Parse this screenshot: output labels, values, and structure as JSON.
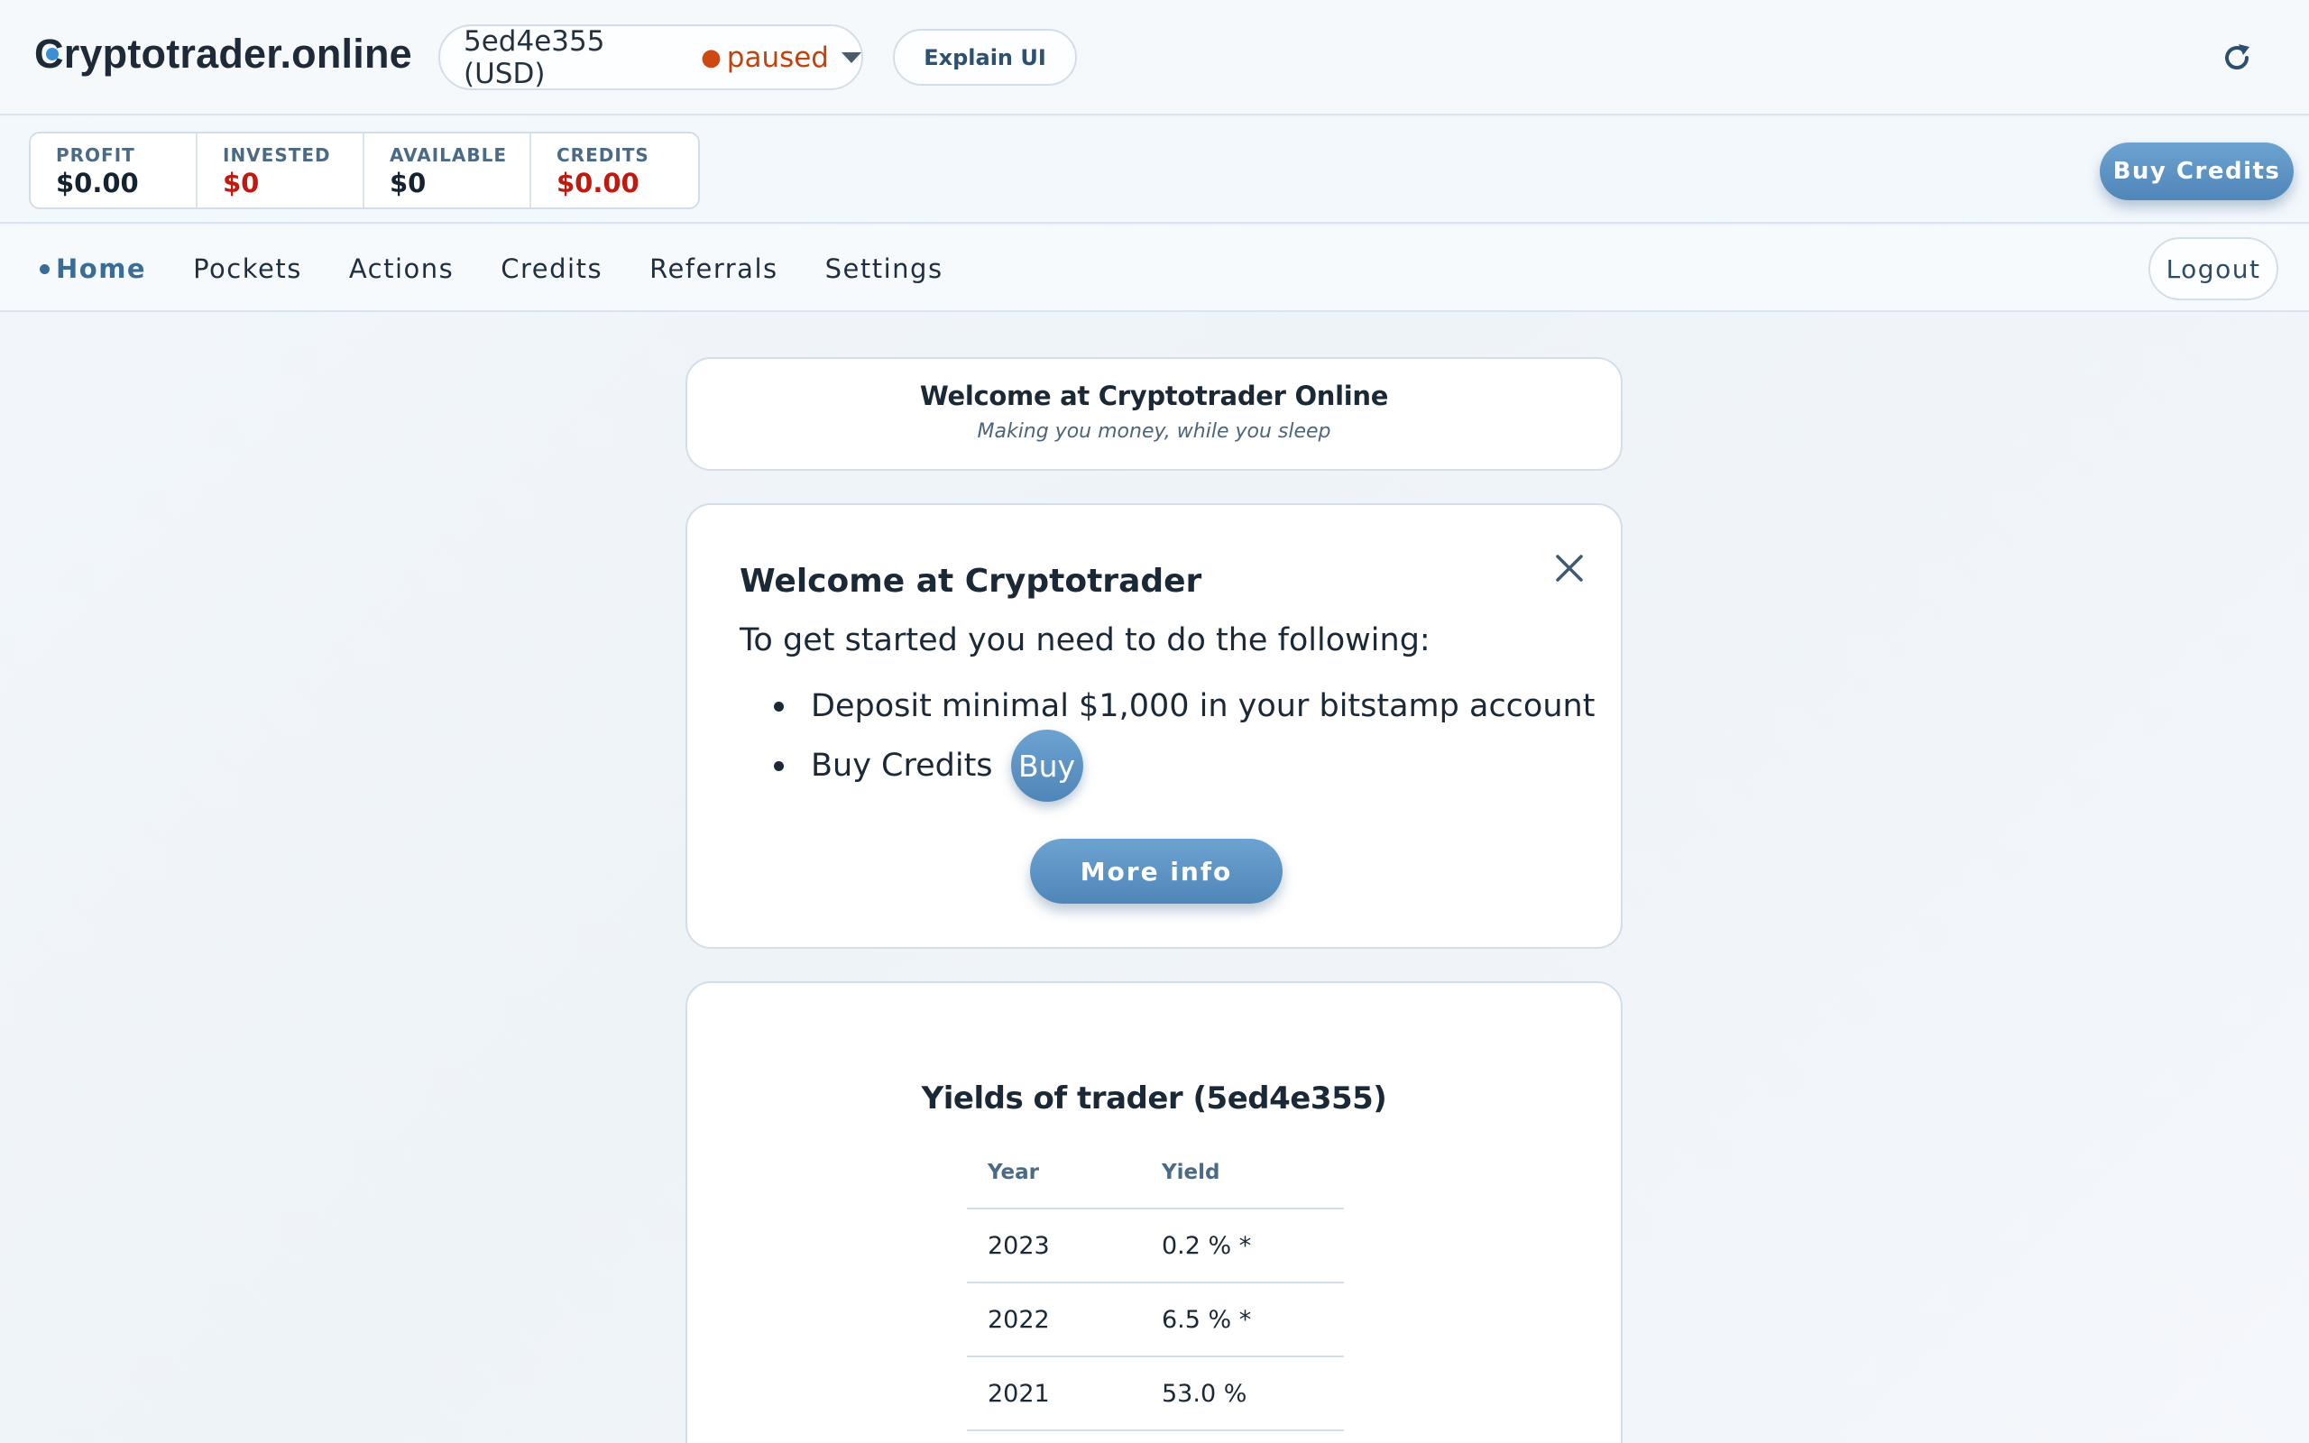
{
  "header": {
    "logo_text": "Cryptotrader.online",
    "trader": {
      "id_label": "5ed4e355 (USD)",
      "status_dot": "●",
      "status": "paused",
      "status_color": "#c3430d"
    },
    "explain_label": "Explain UI",
    "refresh_icon": "refresh-icon"
  },
  "stats": [
    {
      "label": "PROFIT",
      "value": "$0.00",
      "negative": false
    },
    {
      "label": "INVESTED",
      "value": "$0",
      "negative": true
    },
    {
      "label": "AVAILABLE",
      "value": "$0",
      "negative": false
    },
    {
      "label": "CREDITS",
      "value": "$0.00",
      "negative": true
    }
  ],
  "buy_credits_label": "Buy Credits",
  "nav": {
    "items": [
      {
        "label": "Home",
        "active": true
      },
      {
        "label": "Pockets",
        "active": false
      },
      {
        "label": "Actions",
        "active": false
      },
      {
        "label": "Credits",
        "active": false
      },
      {
        "label": "Referrals",
        "active": false
      },
      {
        "label": "Settings",
        "active": false
      }
    ],
    "logout_label": "Logout"
  },
  "welcome": {
    "title": "Welcome at Cryptotrader Online",
    "subtitle": "Making you money, while you sleep"
  },
  "getting_started": {
    "title": "Welcome at Cryptotrader",
    "intro": "To get started you need to do the following:",
    "steps": [
      "Deposit minimal $1,000 in your bitstamp account",
      "Buy Credits"
    ],
    "buy_label": "Buy",
    "more_info_label": "More info",
    "close_icon": "close-icon"
  },
  "yields": {
    "title": "Yields of trader (5ed4e355)",
    "columns": [
      "Year",
      "Yield"
    ],
    "rows": [
      [
        "2023",
        "0.2 % *"
      ],
      [
        "2022",
        "6.5 % *"
      ],
      [
        "2021",
        "53.0 %"
      ]
    ]
  },
  "colors": {
    "accent": "#4f86b8",
    "negative": "#c0190f",
    "nav_active": "#3a6c98"
  }
}
